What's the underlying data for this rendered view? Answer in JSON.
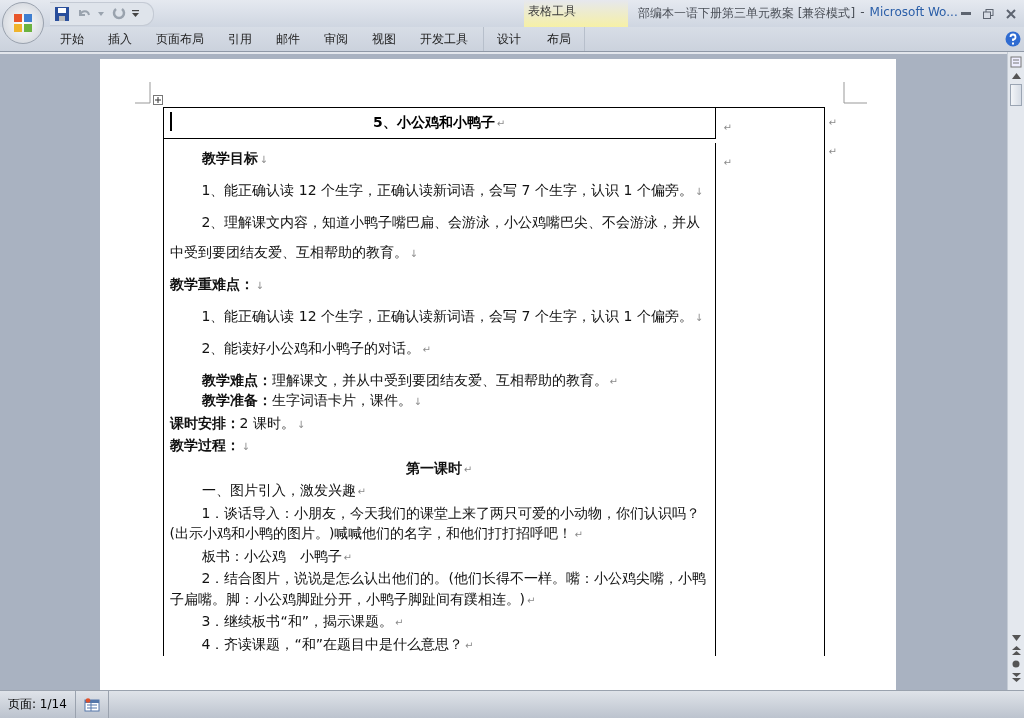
{
  "window": {
    "title_document": "部编本一语下册第三单元教案 [兼容模式]",
    "title_separator": "-",
    "title_app": "Microsoft Wo..."
  },
  "contextual_group": {
    "label": "表格工具",
    "tabs": [
      {
        "label": "设计",
        "selected": false
      },
      {
        "label": "布局",
        "selected": false
      }
    ]
  },
  "ribbon_tabs": [
    {
      "label": "开始",
      "selected": false
    },
    {
      "label": "插入",
      "selected": false
    },
    {
      "label": "页面布局",
      "selected": false
    },
    {
      "label": "引用",
      "selected": false
    },
    {
      "label": "邮件",
      "selected": false
    },
    {
      "label": "审阅",
      "selected": false
    },
    {
      "label": "视图",
      "selected": false
    },
    {
      "label": "开发工具",
      "selected": false
    }
  ],
  "document": {
    "table": {
      "header_row": {
        "title": "5、小公鸡和小鸭子",
        "title_mark": "↵",
        "side_mark": "↵",
        "row_end_mark": "↵"
      },
      "body_row": {
        "side_mark": "↵",
        "row_end_mark": "↵",
        "sections": [
          {
            "kind": "loose",
            "paragraphs": [
              {
                "text": "教学目标",
                "mark": "↓",
                "indent": true,
                "bold": true,
                "center": false
              },
              {
                "text": "1、能正确认读 12 个生字，正确认读新词语，会写 7 个生字，认识 1 个偏旁。",
                "mark": "↓",
                "indent": true,
                "bold": false,
                "center": false
              },
              {
                "text": "2、理解课文内容，知道小鸭子嘴巴扁、会游泳，小公鸡嘴巴尖、不会游泳，并从中受到要团结友爱、互相帮助的教育。",
                "mark": "↓",
                "indent": true,
                "bold": false,
                "center": false
              },
              {
                "text": "教学重难点：",
                "mark": "↓",
                "indent": false,
                "bold": true,
                "center": false
              },
              {
                "text": "1、能正确认读 12 个生字，正确认读新词语，会写 7 个生字，认识 1 个偏旁。",
                "mark": "↓",
                "indent": true,
                "bold": false,
                "center": false
              },
              {
                "text": "2、能读好小公鸡和小鸭子的对话。",
                "mark": "↵",
                "indent": true,
                "bold": false,
                "center": false
              },
              {
                "text": "**教学难点：**理解课文，并从中受到要团结友爱、互相帮助的教育。",
                "mark": "↵",
                "indent": true,
                "bold": false,
                "center": false
              }
            ]
          },
          {
            "kind": "tight",
            "paragraphs": [
              {
                "text": "**教学准备：**生字词语卡片，课件。",
                "mark": "↓",
                "indent": true,
                "bold": false,
                "center": false
              },
              {
                "text": "**课时安排：**2 课时。",
                "mark": "↓",
                "indent": false,
                "bold": false,
                "center": false
              },
              {
                "text": "教学过程：",
                "mark": "↓",
                "indent": false,
                "bold": true,
                "center": false
              },
              {
                "text": "第一课时",
                "mark": "↵",
                "indent": false,
                "bold": true,
                "center": true
              },
              {
                "text": "一、图片引入，激发兴趣",
                "mark": "↵",
                "indent": true,
                "bold": false,
                "center": false
              },
              {
                "text": "1．谈话导入：小朋友，今天我们的课堂上来了两只可爱的小动物，你们认识吗？(出示小鸡和小鸭的图片。)喊喊他们的名字，和他们打打招呼吧！",
                "mark": "↵",
                "indent": true,
                "bold": false,
                "center": false
              },
              {
                "text": "板书：小公鸡　小鸭子",
                "mark": "↵",
                "indent": true,
                "bold": false,
                "center": false
              },
              {
                "text": "2．结合图片，说说是怎么认出他们的。(他们长得不一样。嘴：小公鸡尖嘴，小鸭子扁嘴。脚：小公鸡脚趾分开，小鸭子脚趾间有蹼相连。)",
                "mark": "↵",
                "indent": true,
                "bold": false,
                "center": false
              },
              {
                "text": "3．继续板书“和”，揭示课题。",
                "mark": "↵",
                "indent": true,
                "bold": false,
                "center": false
              },
              {
                "text": "4．齐读课题，“和”在题目中是什么意思？",
                "mark": "↵",
                "indent": true,
                "bold": false,
                "center": false
              }
            ]
          }
        ]
      }
    }
  },
  "status_bar": {
    "page": "页面: 1/14"
  }
}
